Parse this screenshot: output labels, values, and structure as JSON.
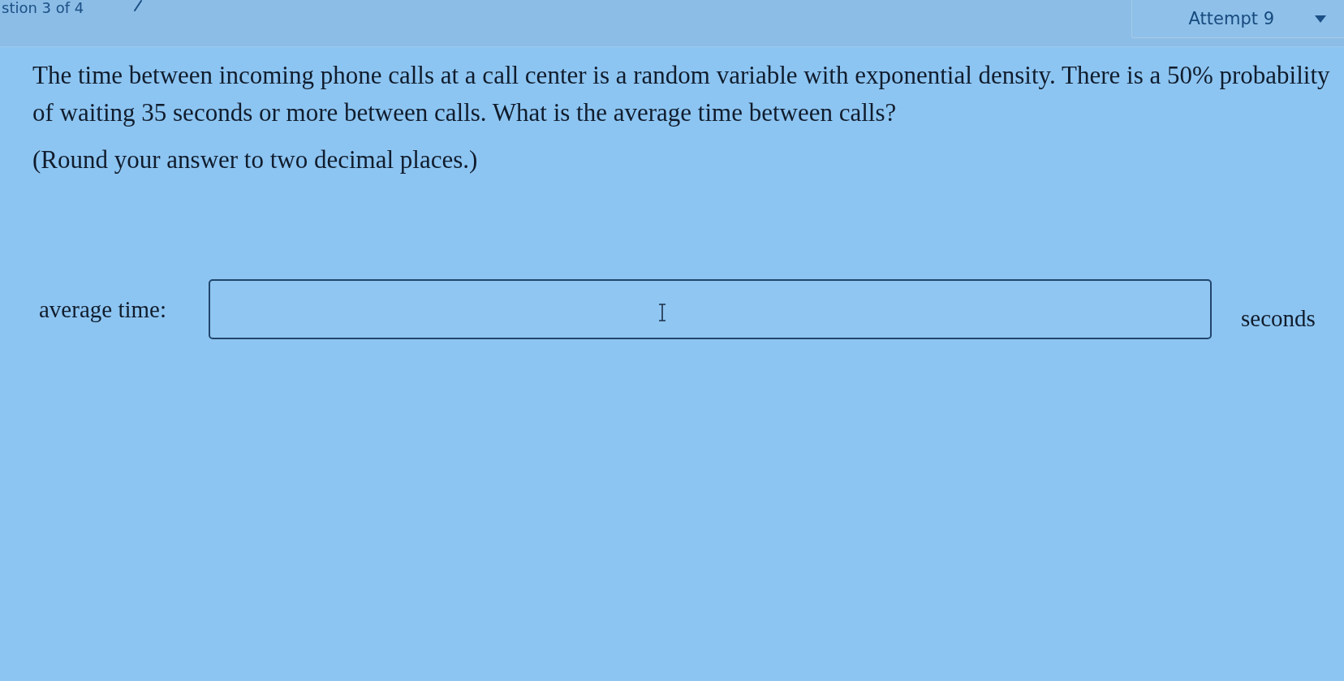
{
  "header": {
    "question_nav": {
      "label": "stion 3 of 4"
    },
    "attempt": {
      "label": "Attempt 9"
    }
  },
  "question": {
    "paragraphs": [
      "The time between incoming phone calls at a call center is a random variable with exponential density. There is a 50% probability of waiting 35 seconds or more between calls. What is the average time between calls?",
      "(Round your answer to two decimal places.)"
    ]
  },
  "answer": {
    "label": "average time:",
    "unit": "seconds"
  }
}
